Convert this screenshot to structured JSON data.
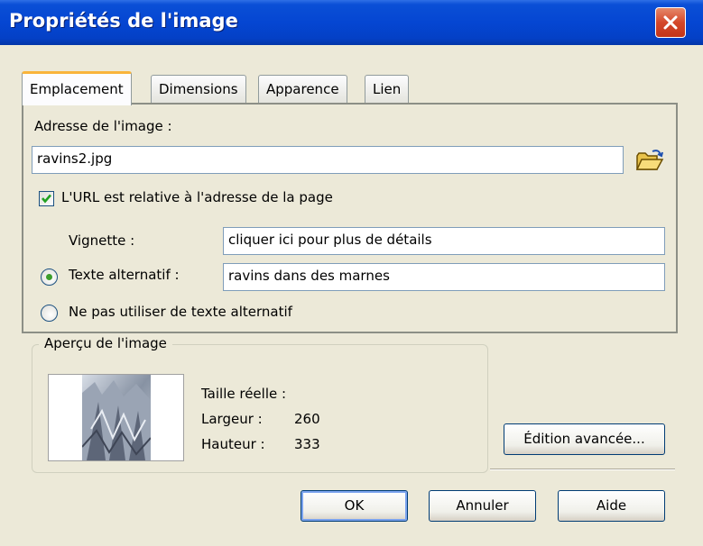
{
  "window": {
    "title": "Propriétés de l'image"
  },
  "tabs": [
    {
      "label": "Emplacement",
      "active": true
    },
    {
      "label": "Dimensions",
      "active": false
    },
    {
      "label": "Apparence",
      "active": false
    },
    {
      "label": "Lien",
      "active": false
    }
  ],
  "location": {
    "address_label": "Adresse de l'image :",
    "address_value": "ravins2.jpg",
    "relative_url_label": "L'URL est relative à l'adresse de la page",
    "relative_url_checked": true,
    "tooltip_label": "Vignette :",
    "tooltip_value": "cliquer ici pour plus de détails",
    "alt_text_label": "Texte alternatif :",
    "alt_text_value": "ravins dans des marnes",
    "alt_text_selected": true,
    "no_alt_label": "Ne pas utiliser de texte alternatif",
    "browse_icon": "open-folder-icon"
  },
  "preview": {
    "legend": "Aperçu de l'image",
    "real_size_label": "Taille réelle :",
    "width_label": "Largeur :",
    "width_value": "260",
    "height_label": "Hauteur :",
    "height_value": "333"
  },
  "buttons": {
    "advanced_edit": "Édition avancée...",
    "ok": "OK",
    "cancel": "Annuler",
    "help": "Aide"
  },
  "colors": {
    "titlebar": "#0546d2",
    "tab_accent": "#f9b43b",
    "close_button": "#d4472a",
    "check_green": "#3c9d2c"
  }
}
